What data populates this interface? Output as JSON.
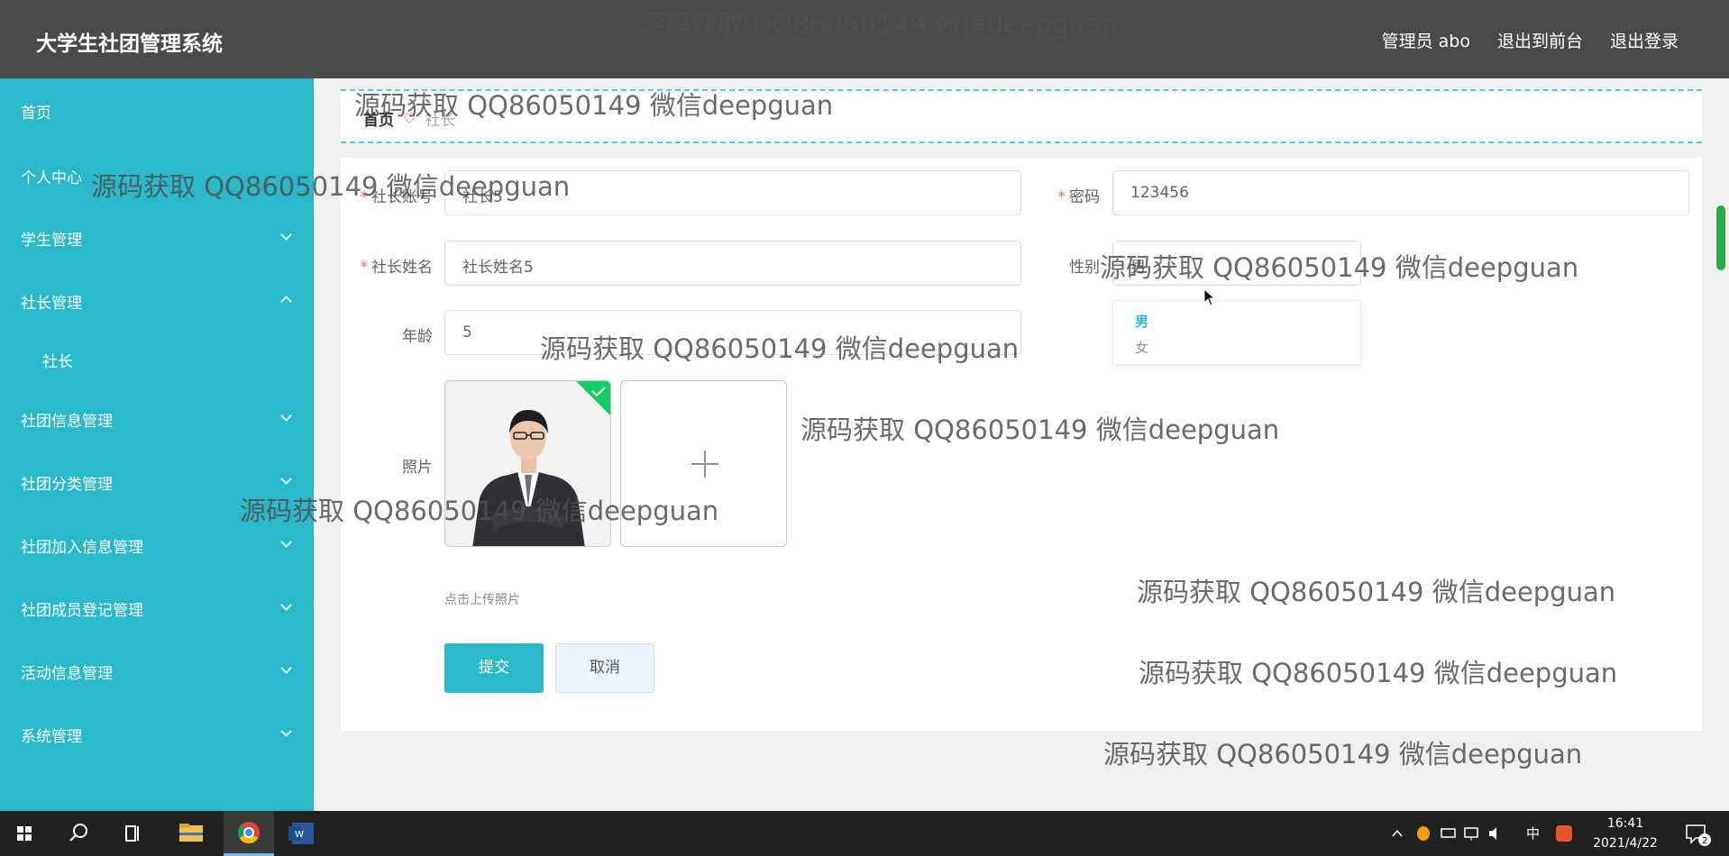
{
  "app": {
    "title": "大学生社团管理系统",
    "user_label": "管理员 abo",
    "front_label": "退出到前台",
    "logout_label": "退出登录"
  },
  "sidebar": {
    "items": [
      {
        "label": "首页"
      },
      {
        "label": "个人中心"
      },
      {
        "label": "学生管理"
      },
      {
        "label": "社长管理"
      },
      {
        "label": "社长"
      },
      {
        "label": "社团信息管理"
      },
      {
        "label": "社团分类管理"
      },
      {
        "label": "社团加入信息管理"
      },
      {
        "label": "社团成员登记管理"
      },
      {
        "label": "活动信息管理"
      },
      {
        "label": "系统管理"
      }
    ]
  },
  "breadcrumb": {
    "home": "首页",
    "separator": "♡",
    "current": "社长"
  },
  "form": {
    "account": {
      "label": "社长账号",
      "value": "社长5"
    },
    "password": {
      "label": "密码",
      "value": "123456"
    },
    "name": {
      "label": "社长姓名",
      "value": "社长姓名5"
    },
    "gender": {
      "label": "性别",
      "value": "男",
      "options": [
        "男",
        "女"
      ]
    },
    "age": {
      "label": "年龄",
      "value": "5"
    },
    "photo": {
      "label": "照片",
      "hint": "点击上传照片"
    },
    "submit_label": "提交",
    "cancel_label": "取消"
  },
  "watermark": {
    "text": "源码获取 QQ86050149 微信deepguan"
  },
  "taskbar": {
    "time": "16:41",
    "date": "2021/4/22",
    "ime": "中",
    "notifications": "2"
  },
  "colors": {
    "header": "#4a4a4a",
    "sidebar": "#2ab9cb",
    "accent": "#2ab9cb",
    "required": "#f56c6c"
  }
}
